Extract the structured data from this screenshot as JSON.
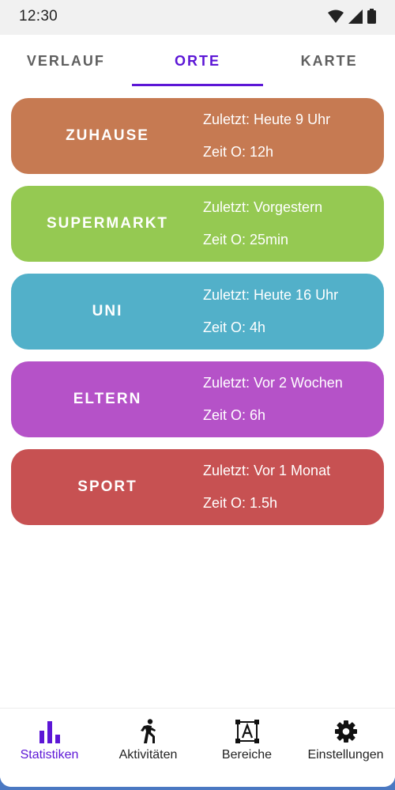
{
  "status_bar": {
    "time": "12:30"
  },
  "tabs": [
    {
      "label": "VERLAUF",
      "active": false
    },
    {
      "label": "ORTE",
      "active": true
    },
    {
      "label": "KARTE",
      "active": false
    }
  ],
  "places": [
    {
      "name": "ZUHAUSE",
      "last": "Zuletzt: Heute 9 Uhr",
      "time": "Zeit O: 12h",
      "color": "#c67a52"
    },
    {
      "name": "SUPERMARKT",
      "last": "Zuletzt: Vorgestern",
      "time": "Zeit O: 25min",
      "color": "#95c952"
    },
    {
      "name": "UNI",
      "last": "Zuletzt: Heute 16 Uhr",
      "time": "Zeit O: 4h",
      "color": "#52b0c9"
    },
    {
      "name": "ELTERN",
      "last": "Zuletzt: Vor 2 Wochen",
      "time": "Zeit O: 6h",
      "color": "#b552c8"
    },
    {
      "name": "SPORT",
      "last": "Zuletzt: Vor 1 Monat",
      "time": "Zeit O: 1.5h",
      "color": "#c75152"
    }
  ],
  "bottom_nav": [
    {
      "label": "Statistiken",
      "icon": "bar-chart-icon",
      "active": true
    },
    {
      "label": "Aktivitäten",
      "icon": "walking-person-icon",
      "active": false
    },
    {
      "label": "Bereiche",
      "icon": "text-select-icon",
      "active": false
    },
    {
      "label": "Einstellungen",
      "icon": "gear-icon",
      "active": false
    }
  ],
  "colors": {
    "accent": "#5c16d6",
    "frame": "#4a78c2"
  }
}
